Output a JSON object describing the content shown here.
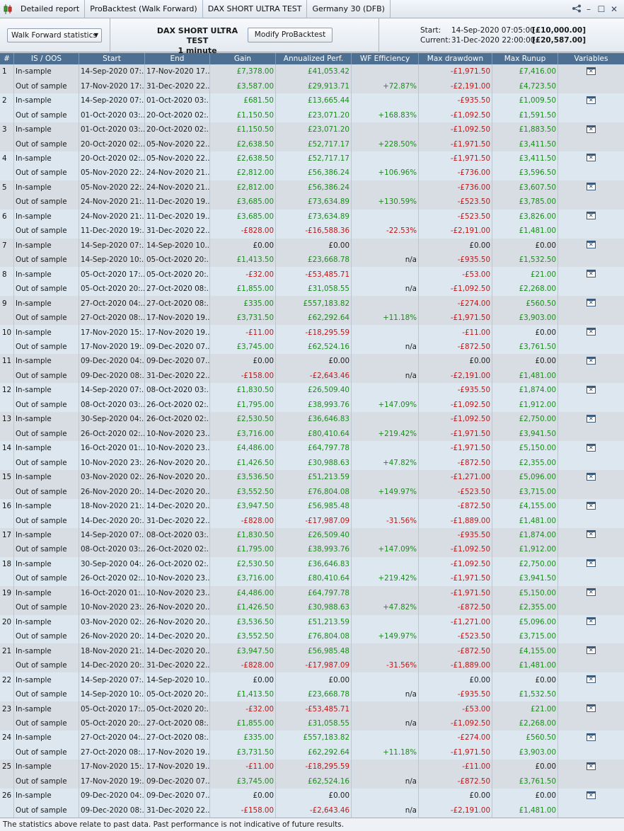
{
  "tabs": [
    {
      "label": "Detailed report",
      "icon": "candlestick-icon"
    },
    {
      "label": "ProBacktest (Walk Forward)"
    },
    {
      "label": "DAX SHORT ULTRA TEST"
    },
    {
      "label": "Germany 30 (DFB)"
    }
  ],
  "window_controls": [
    "share-icon",
    "minimize-icon",
    "maximize-icon",
    "close-icon"
  ],
  "header": {
    "dropdown": "Walk Forward statistics",
    "strategy_name": "DAX SHORT ULTRA TEST",
    "timeframe": "1 minute",
    "modify_button": "Modify ProBacktest",
    "start_label": "Start:",
    "start_date": "14-Sep-2020 07:05:00",
    "start_capital": "[£10,000.00]",
    "current_label": "Current:",
    "current_date": "31-Dec-2020 22:00:00",
    "current_capital": "[£20,587.00]"
  },
  "columns": [
    "#",
    "IS / OOS",
    "Start",
    "End",
    "Gain",
    "Annualized Perf.",
    "WF Efficiency",
    "Max drawdown",
    "Max Runup",
    "Variables"
  ],
  "rows": [
    {
      "n": "1",
      "is": [
        "14-Sep-2020 07:...",
        "17-Nov-2020 17...",
        "£7,378.00",
        "£41,053.42",
        "",
        "-£1,971.50",
        "£7,416.00"
      ],
      "oos": [
        "17-Nov-2020 17:...",
        "31-Dec-2020 22...",
        "£3,587.00",
        "£29,913.71",
        "+72.87%",
        "-£2,191.00",
        "£4,723.50"
      ]
    },
    {
      "n": "2",
      "is": [
        "14-Sep-2020 07:...",
        "01-Oct-2020 03:...",
        "£681.50",
        "£13,665.44",
        "",
        "-£935.50",
        "£1,009.50"
      ],
      "oos": [
        "01-Oct-2020 03:...",
        "20-Oct-2020 02:...",
        "£1,150.50",
        "£23,071.20",
        "+168.83%",
        "-£1,092.50",
        "£1,591.50"
      ]
    },
    {
      "n": "3",
      "is": [
        "01-Oct-2020 03:...",
        "20-Oct-2020 02:...",
        "£1,150.50",
        "£23,071.20",
        "",
        "-£1,092.50",
        "£1,883.50"
      ],
      "oos": [
        "20-Oct-2020 02:...",
        "05-Nov-2020 22...",
        "£2,638.50",
        "£52,717.17",
        "+228.50%",
        "-£1,971.50",
        "£3,411.50"
      ]
    },
    {
      "n": "4",
      "is": [
        "20-Oct-2020 02:...",
        "05-Nov-2020 22...",
        "£2,638.50",
        "£52,717.17",
        "",
        "-£1,971.50",
        "£3,411.50"
      ],
      "oos": [
        "05-Nov-2020 22:...",
        "24-Nov-2020 21...",
        "£2,812.00",
        "£56,386.24",
        "+106.96%",
        "-£736.00",
        "£3,596.50"
      ]
    },
    {
      "n": "5",
      "is": [
        "05-Nov-2020 22:...",
        "24-Nov-2020 21...",
        "£2,812.00",
        "£56,386.24",
        "",
        "-£736.00",
        "£3,607.50"
      ],
      "oos": [
        "24-Nov-2020 21:...",
        "11-Dec-2020 19...",
        "£3,685.00",
        "£73,634.89",
        "+130.59%",
        "-£523.50",
        "£3,785.00"
      ]
    },
    {
      "n": "6",
      "is": [
        "24-Nov-2020 21:...",
        "11-Dec-2020 19...",
        "£3,685.00",
        "£73,634.89",
        "",
        "-£523.50",
        "£3,826.00"
      ],
      "oos": [
        "11-Dec-2020 19:...",
        "31-Dec-2020 22...",
        "-£828.00",
        "-£16,588.36",
        "-22.53%",
        "-£2,191.00",
        "£1,481.00"
      ]
    },
    {
      "n": "7",
      "is": [
        "14-Sep-2020 07:...",
        "14-Sep-2020 10...",
        "£0.00",
        "£0.00",
        "",
        "£0.00",
        "£0.00"
      ],
      "oos": [
        "14-Sep-2020 10:...",
        "05-Oct-2020 20:...",
        "£1,413.50",
        "£23,668.78",
        "n/a",
        "-£935.50",
        "£1,532.50"
      ]
    },
    {
      "n": "8",
      "is": [
        "05-Oct-2020 17:...",
        "05-Oct-2020 20:...",
        "-£32.00",
        "-£53,485.71",
        "",
        "-£53.00",
        "£21.00"
      ],
      "oos": [
        "05-Oct-2020 20:...",
        "27-Oct-2020 08:...",
        "£1,855.00",
        "£31,058.55",
        "n/a",
        "-£1,092.50",
        "£2,268.00"
      ]
    },
    {
      "n": "9",
      "is": [
        "27-Oct-2020 04:...",
        "27-Oct-2020 08:...",
        "£335.00",
        "£557,183.82",
        "",
        "-£274.00",
        "£560.50"
      ],
      "oos": [
        "27-Oct-2020 08:...",
        "17-Nov-2020 19...",
        "£3,731.50",
        "£62,292.64",
        "+11.18%",
        "-£1,971.50",
        "£3,903.00"
      ]
    },
    {
      "n": "10",
      "is": [
        "17-Nov-2020 15:...",
        "17-Nov-2020 19...",
        "-£11.00",
        "-£18,295.59",
        "",
        "-£11.00",
        "£0.00"
      ],
      "oos": [
        "17-Nov-2020 19:...",
        "09-Dec-2020 07...",
        "£3,745.00",
        "£62,524.16",
        "n/a",
        "-£872.50",
        "£3,761.50"
      ]
    },
    {
      "n": "11",
      "is": [
        "09-Dec-2020 04:...",
        "09-Dec-2020 07...",
        "£0.00",
        "£0.00",
        "",
        "£0.00",
        "£0.00"
      ],
      "oos": [
        "09-Dec-2020 08:...",
        "31-Dec-2020 22...",
        "-£158.00",
        "-£2,643.46",
        "n/a",
        "-£2,191.00",
        "£1,481.00"
      ]
    },
    {
      "n": "12",
      "is": [
        "14-Sep-2020 07:...",
        "08-Oct-2020 03:...",
        "£1,830.50",
        "£26,509.40",
        "",
        "-£935.50",
        "£1,874.00"
      ],
      "oos": [
        "08-Oct-2020 03:...",
        "26-Oct-2020 02:...",
        "£1,795.00",
        "£38,993.76",
        "+147.09%",
        "-£1,092.50",
        "£1,912.00"
      ]
    },
    {
      "n": "13",
      "is": [
        "30-Sep-2020 04:...",
        "26-Oct-2020 02:...",
        "£2,530.50",
        "£36,646.83",
        "",
        "-£1,092.50",
        "£2,750.00"
      ],
      "oos": [
        "26-Oct-2020 02:...",
        "10-Nov-2020 23...",
        "£3,716.00",
        "£80,410.64",
        "+219.42%",
        "-£1,971.50",
        "£3,941.50"
      ]
    },
    {
      "n": "14",
      "is": [
        "16-Oct-2020 01:...",
        "10-Nov-2020 23...",
        "£4,486.00",
        "£64,797.78",
        "",
        "-£1,971.50",
        "£5,150.00"
      ],
      "oos": [
        "10-Nov-2020 23:...",
        "26-Nov-2020 20...",
        "£1,426.50",
        "£30,988.63",
        "+47.82%",
        "-£872.50",
        "£2,355.00"
      ]
    },
    {
      "n": "15",
      "is": [
        "03-Nov-2020 02:...",
        "26-Nov-2020 20...",
        "£3,536.50",
        "£51,213.59",
        "",
        "-£1,271.00",
        "£5,096.00"
      ],
      "oos": [
        "26-Nov-2020 20:...",
        "14-Dec-2020 20...",
        "£3,552.50",
        "£76,804.08",
        "+149.97%",
        "-£523.50",
        "£3,715.00"
      ]
    },
    {
      "n": "16",
      "is": [
        "18-Nov-2020 21:...",
        "14-Dec-2020 20...",
        "£3,947.50",
        "£56,985.48",
        "",
        "-£872.50",
        "£4,155.00"
      ],
      "oos": [
        "14-Dec-2020 20:...",
        "31-Dec-2020 22...",
        "-£828.00",
        "-£17,987.09",
        "-31.56%",
        "-£1,889.00",
        "£1,481.00"
      ]
    },
    {
      "n": "17",
      "is": [
        "14-Sep-2020 07:...",
        "08-Oct-2020 03:...",
        "£1,830.50",
        "£26,509.40",
        "",
        "-£935.50",
        "£1,874.00"
      ],
      "oos": [
        "08-Oct-2020 03:...",
        "26-Oct-2020 02:...",
        "£1,795.00",
        "£38,993.76",
        "+147.09%",
        "-£1,092.50",
        "£1,912.00"
      ]
    },
    {
      "n": "18",
      "is": [
        "30-Sep-2020 04:...",
        "26-Oct-2020 02:...",
        "£2,530.50",
        "£36,646.83",
        "",
        "-£1,092.50",
        "£2,750.00"
      ],
      "oos": [
        "26-Oct-2020 02:...",
        "10-Nov-2020 23...",
        "£3,716.00",
        "£80,410.64",
        "+219.42%",
        "-£1,971.50",
        "£3,941.50"
      ]
    },
    {
      "n": "19",
      "is": [
        "16-Oct-2020 01:...",
        "10-Nov-2020 23...",
        "£4,486.00",
        "£64,797.78",
        "",
        "-£1,971.50",
        "£5,150.00"
      ],
      "oos": [
        "10-Nov-2020 23:...",
        "26-Nov-2020 20...",
        "£1,426.50",
        "£30,988.63",
        "+47.82%",
        "-£872.50",
        "£2,355.00"
      ]
    },
    {
      "n": "20",
      "is": [
        "03-Nov-2020 02:...",
        "26-Nov-2020 20...",
        "£3,536.50",
        "£51,213.59",
        "",
        "-£1,271.00",
        "£5,096.00"
      ],
      "oos": [
        "26-Nov-2020 20:...",
        "14-Dec-2020 20...",
        "£3,552.50",
        "£76,804.08",
        "+149.97%",
        "-£523.50",
        "£3,715.00"
      ]
    },
    {
      "n": "21",
      "is": [
        "18-Nov-2020 21:...",
        "14-Dec-2020 20...",
        "£3,947.50",
        "£56,985.48",
        "",
        "-£872.50",
        "£4,155.00"
      ],
      "oos": [
        "14-Dec-2020 20:...",
        "31-Dec-2020 22...",
        "-£828.00",
        "-£17,987.09",
        "-31.56%",
        "-£1,889.00",
        "£1,481.00"
      ]
    },
    {
      "n": "22",
      "is": [
        "14-Sep-2020 07:...",
        "14-Sep-2020 10...",
        "£0.00",
        "£0.00",
        "",
        "£0.00",
        "£0.00"
      ],
      "oos": [
        "14-Sep-2020 10:...",
        "05-Oct-2020 20:...",
        "£1,413.50",
        "£23,668.78",
        "n/a",
        "-£935.50",
        "£1,532.50"
      ]
    },
    {
      "n": "23",
      "is": [
        "05-Oct-2020 17:...",
        "05-Oct-2020 20:...",
        "-£32.00",
        "-£53,485.71",
        "",
        "-£53.00",
        "£21.00"
      ],
      "oos": [
        "05-Oct-2020 20:...",
        "27-Oct-2020 08:...",
        "£1,855.00",
        "£31,058.55",
        "n/a",
        "-£1,092.50",
        "£2,268.00"
      ]
    },
    {
      "n": "24",
      "is": [
        "27-Oct-2020 04:...",
        "27-Oct-2020 08:...",
        "£335.00",
        "£557,183.82",
        "",
        "-£274.00",
        "£560.50"
      ],
      "oos": [
        "27-Oct-2020 08:...",
        "17-Nov-2020 19...",
        "£3,731.50",
        "£62,292.64",
        "+11.18%",
        "-£1,971.50",
        "£3,903.00"
      ]
    },
    {
      "n": "25",
      "is": [
        "17-Nov-2020 15:...",
        "17-Nov-2020 19...",
        "-£11.00",
        "-£18,295.59",
        "",
        "-£11.00",
        "£0.00"
      ],
      "oos": [
        "17-Nov-2020 19:...",
        "09-Dec-2020 07...",
        "£3,745.00",
        "£62,524.16",
        "n/a",
        "-£872.50",
        "£3,761.50"
      ]
    },
    {
      "n": "26",
      "is": [
        "09-Dec-2020 04:...",
        "09-Dec-2020 07...",
        "£0.00",
        "£0.00",
        "",
        "£0.00",
        "£0.00"
      ],
      "oos": [
        "09-Dec-2020 08:...",
        "31-Dec-2020 22...",
        "-£158.00",
        "-£2,643.46",
        "n/a",
        "-£2,191.00",
        "£1,481.00"
      ]
    }
  ],
  "row_labels": {
    "in_sample": "In-sample",
    "out_of_sample": "Out of sample"
  },
  "colors": {
    "positive": "#1a8c1a",
    "negative": "#c01616",
    "header": "#4d6f92"
  },
  "footer": "The statistics above relate to past data. Past performance is not indicative of future results."
}
